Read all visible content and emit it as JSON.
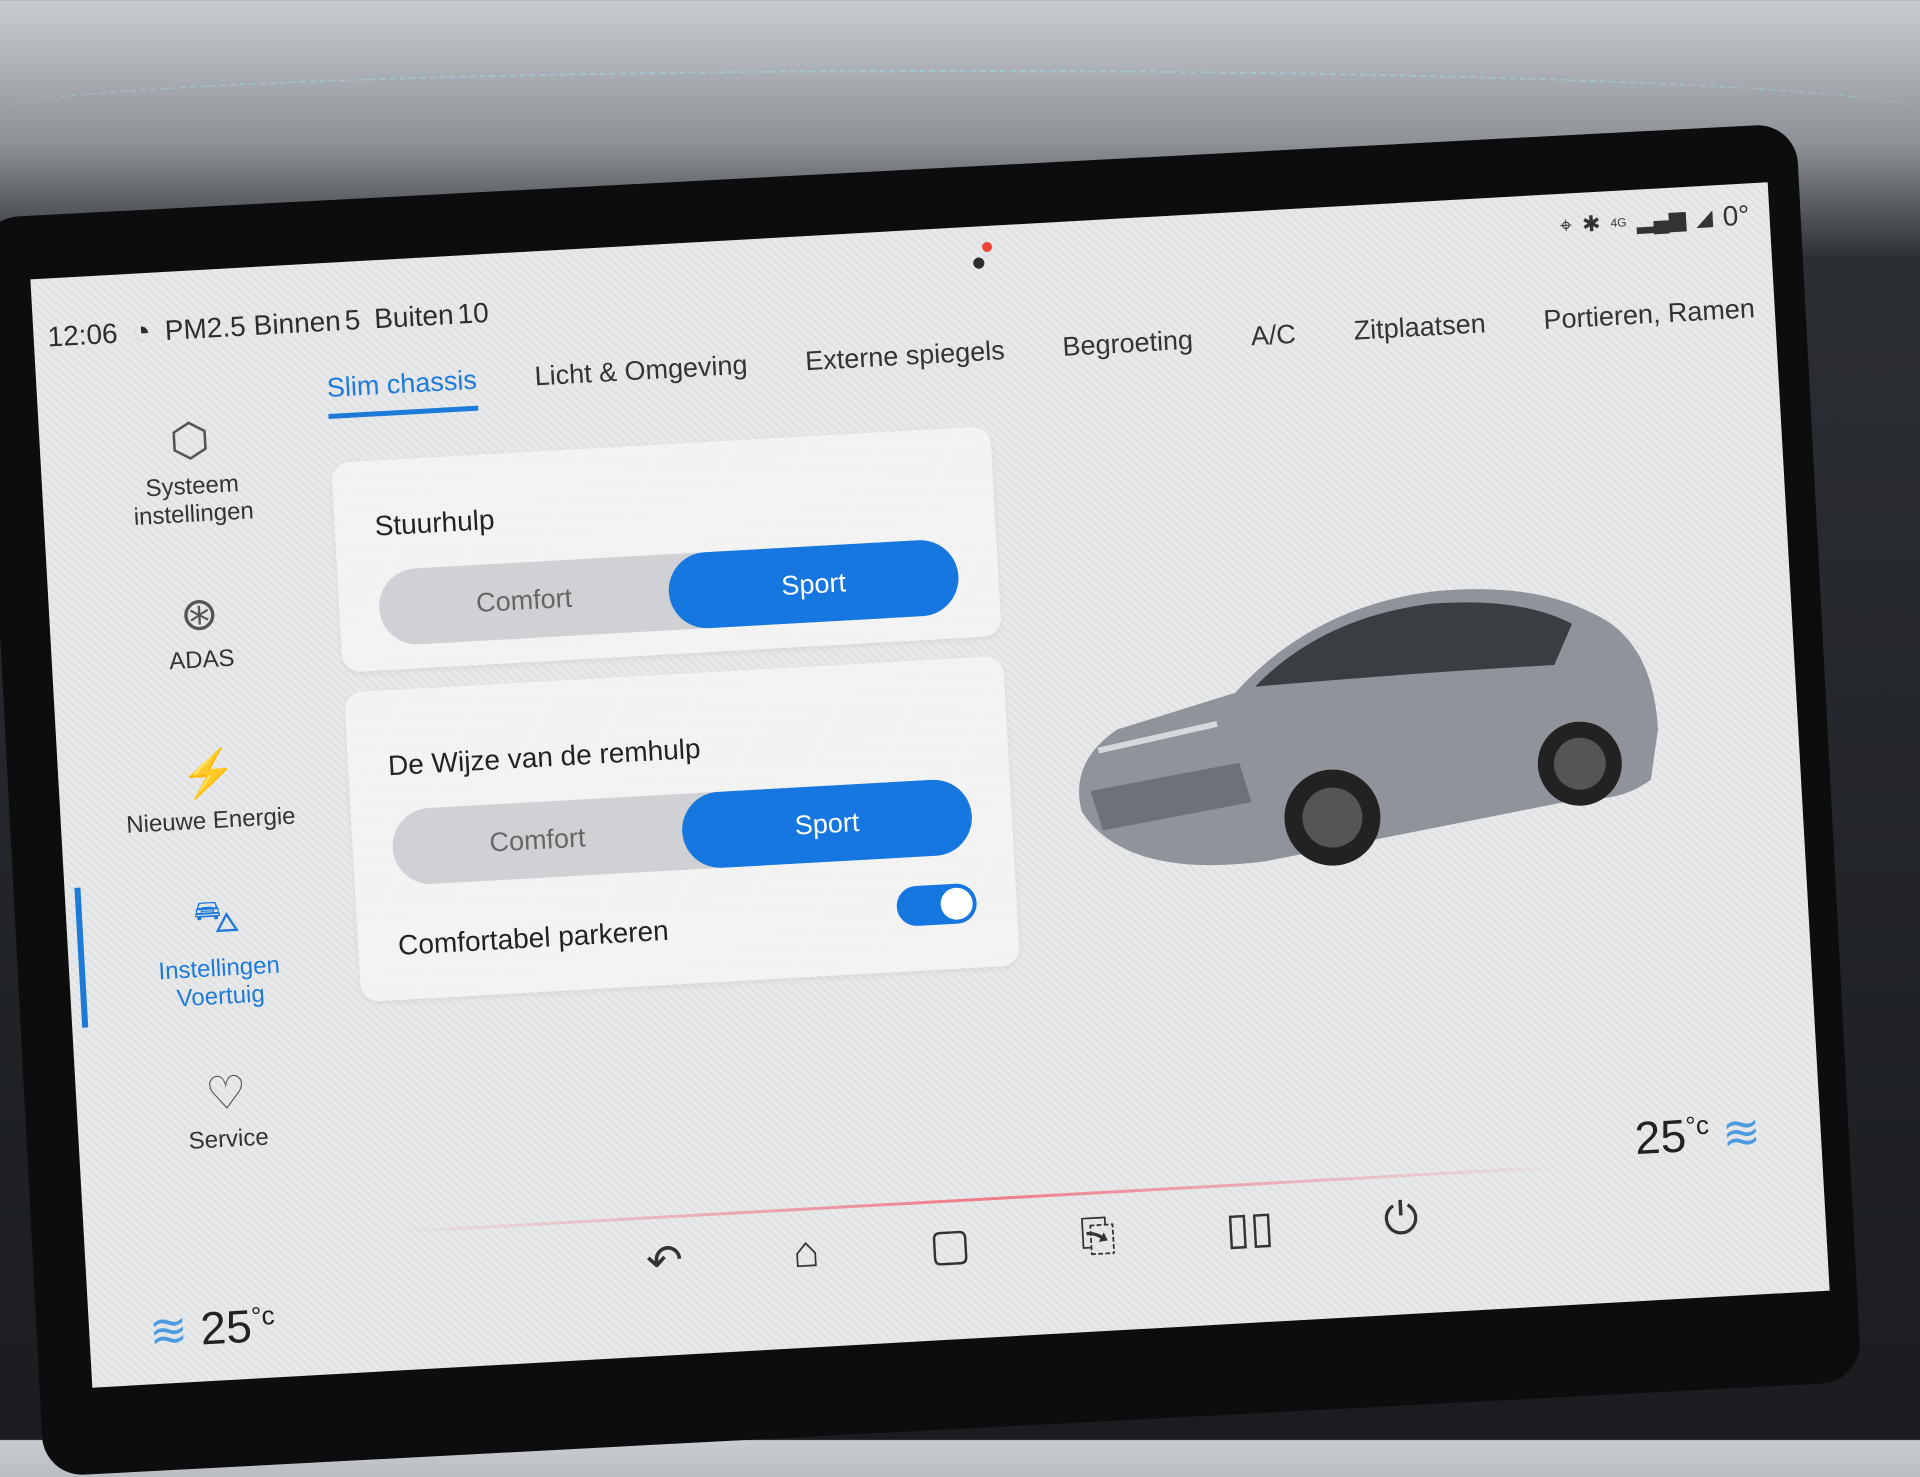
{
  "status_bar": {
    "time": "12:06",
    "air_quality_icon": "gauge-speaker-icon",
    "pm_label": "PM2.5",
    "inside_label": "Binnen",
    "inside_value": "5",
    "outside_label": "Buiten",
    "outside_value": "10",
    "network": "4G",
    "right_value": "0°"
  },
  "sidebar": {
    "items": [
      {
        "label": "Systeem instellingen",
        "icon": "gear-hex-icon"
      },
      {
        "label": "ADAS",
        "icon": "steering-wheel-icon"
      },
      {
        "label": "Nieuwe Energie",
        "icon": "battery-bolt-icon"
      },
      {
        "label": "Instellingen Voertuig",
        "icon": "car-icon",
        "active": true
      },
      {
        "label": "Service",
        "icon": "car-heart-icon"
      }
    ]
  },
  "tabs": [
    {
      "label": "Slim chassis",
      "active": true
    },
    {
      "label": "Licht & Omgeving"
    },
    {
      "label": "Externe spiegels"
    },
    {
      "label": "Begroeting"
    },
    {
      "label": "A/C"
    },
    {
      "label": "Zitplaatsen"
    },
    {
      "label": "Portieren, Ramen"
    }
  ],
  "steering": {
    "title": "Stuurhulp",
    "options": [
      "Comfort",
      "Sport"
    ],
    "selected": "Sport"
  },
  "braking": {
    "title": "De Wijze van de remhulp",
    "options": [
      "Comfort",
      "Sport"
    ],
    "selected": "Sport"
  },
  "parking": {
    "label": "Comfortabel parkeren",
    "enabled": true
  },
  "climate": {
    "left_temp": "25",
    "right_temp": "25",
    "unit": "°c"
  },
  "colors": {
    "accent": "#1677e0",
    "screen_bg": "#e5e6e7"
  }
}
